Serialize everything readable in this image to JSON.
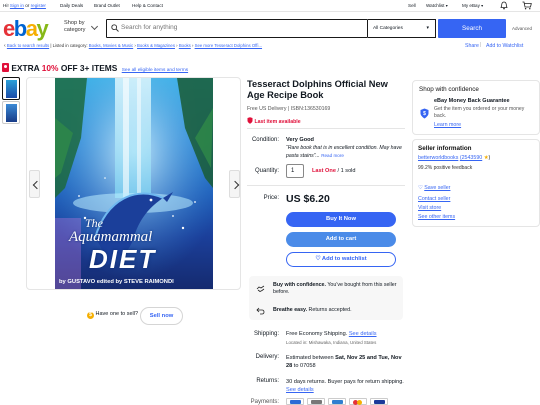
{
  "topbar": {
    "greeting_prefix": "Hi!",
    "sign_in": "Sign in",
    "or": "or",
    "register": "register",
    "daily_deals": "Daily Deals",
    "brand_outlet": "Brand Outlet",
    "help": "Help & Contact",
    "sell": "Sell",
    "watchlist": "Watchlist",
    "my_ebay": "My eBay"
  },
  "header": {
    "logo": [
      "e",
      "b",
      "a",
      "y"
    ],
    "shop_by_category": [
      "Shop by",
      "category"
    ],
    "search_placeholder": "Search for anything",
    "category_select": "All Categories",
    "search_button": "Search",
    "advanced": "Advanced"
  },
  "breadcrumb": {
    "back": "Back to search results",
    "listed_in": "| Listed in category:",
    "items": [
      "Books, Movies & Music",
      "Books & Magazines",
      "Books",
      "See more Tesseract Dolphins Offi..."
    ]
  },
  "actions": {
    "share": "Share",
    "add_to_watchlist": "Add to Watchlist"
  },
  "promo": {
    "prefix": "EXTRA",
    "percent": "10%",
    "suffix": "OFF 3+ ITEMS",
    "link": "See all eligible items and terms"
  },
  "cover": {
    "title_line1": "The",
    "title_line2": "Aquamammal",
    "title_line3": "DIET",
    "byline": "by GUSTAVO edited by STEVE RAIMONDI"
  },
  "sell_prompt": {
    "question": "Have one to sell?",
    "button": "Sell now"
  },
  "product": {
    "title": "Tesseract Dolphins Official New Age Recipe Book",
    "delivery_isbn": "Free US Delivery | ISBN:136530169",
    "last_item": "Last item available",
    "condition_label": "Condition:",
    "condition_value": "Very Good",
    "condition_note": "“Rare book that is in excellent condition. May have pasta stains”...",
    "read_more": "Read more",
    "quantity_label": "Quantity:",
    "quantity_value": "1",
    "stock_highlight": "Last One",
    "stock_rest": "/ 1 sold",
    "price_label": "Price:",
    "price": "US $6.20",
    "buy_now": "Buy It Now",
    "add_to_cart": "Add to cart",
    "add_to_watchlist": "Add to watchlist"
  },
  "confidence_box": {
    "line1_bold": "Buy with confidence.",
    "line1_rest": "You've bought from this seller before.",
    "line2_bold": "Breathe easy.",
    "line2_rest": "Returns accepted."
  },
  "shipping": {
    "label": "Shipping:",
    "value": "Free Economy Shipping.",
    "details_link": "See details",
    "location": "Located in: Mishawaka, Indiana, United States"
  },
  "delivery": {
    "label": "Delivery:",
    "line1": "Estimated between",
    "line1_bold": "Sat, Nov 25 and Tue,",
    "line2_bold": "Nov 28",
    "line2_rest": "to 07058"
  },
  "returns": {
    "label": "Returns:",
    "line1": "30 days returns. Buyer pays for return",
    "line2": "shipping.",
    "details_link": "See details"
  },
  "payments_label": "Payments:",
  "shop_confidence": {
    "title": "Shop with confidence",
    "guarantee_title": "eBay Money Back Guarantee",
    "guarantee_text": "Get the item you ordered or your money back.",
    "learn_more": "Learn more"
  },
  "seller": {
    "title": "Seller information",
    "name": "betterworldbooks",
    "score": "(2543590",
    "feedback": "99.2% positive feedback",
    "save_seller": "Save seller",
    "contact": "Contact seller",
    "visit_store": "Visit store",
    "other_items": "See other items"
  },
  "colors": {
    "ebay_red": "#e53238",
    "ebay_blue": "#0064d2",
    "ebay_yellow": "#f5af02",
    "ebay_green": "#86b817",
    "primary_button": "#3665f3",
    "alert_red": "#e0103a"
  }
}
